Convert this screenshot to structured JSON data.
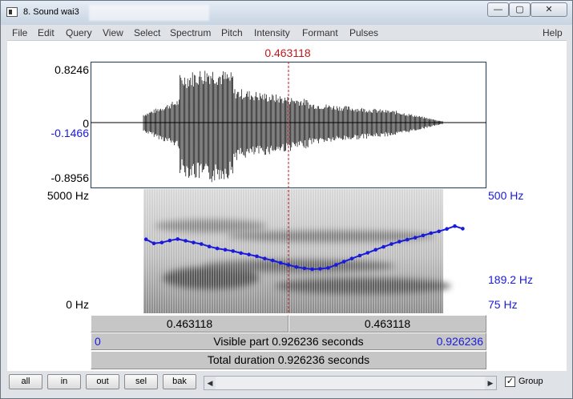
{
  "window": {
    "title": "8. Sound wai3",
    "minimize_glyph": "—",
    "maximize_glyph": "▢",
    "close_glyph": "✕"
  },
  "menu": [
    "File",
    "Edit",
    "Query",
    "View",
    "Select",
    "Spectrum",
    "Pitch",
    "Intensity",
    "Formant",
    "Pulses",
    "Help"
  ],
  "cursor": {
    "time": "0.463118",
    "fraction": 0.5,
    "color": "#c0181a"
  },
  "waveform": {
    "ymax": "0.8246",
    "zero": "0",
    "cursor_value": "-0.1466",
    "ymin": "-0.8956",
    "amp_max": 0.8246,
    "amp_min": -0.8956,
    "cursor_amp": -0.1466
  },
  "spectrogram": {
    "freq_max": "5000 Hz",
    "freq_min": "0 Hz",
    "pitch_max": "500 Hz",
    "pitch_value": "189.2 Hz",
    "pitch_min": "75 Hz",
    "pitch_ceiling_hz": 500,
    "pitch_floor_hz": 75,
    "pitch_color": "#1a1adb"
  },
  "pitch_track": {
    "x_fraction": [
      0.14,
      0.16,
      0.18,
      0.2,
      0.22,
      0.24,
      0.26,
      0.28,
      0.3,
      0.32,
      0.34,
      0.36,
      0.38,
      0.4,
      0.42,
      0.44,
      0.46,
      0.48,
      0.5,
      0.52,
      0.54,
      0.56,
      0.58,
      0.6,
      0.62,
      0.64,
      0.66,
      0.68,
      0.7,
      0.72,
      0.74,
      0.76,
      0.78,
      0.8,
      0.82,
      0.84,
      0.86,
      0.88,
      0.9,
      0.92,
      0.94
    ],
    "hz": [
      232,
      218,
      221,
      228,
      233,
      227,
      221,
      216,
      208,
      202,
      198,
      194,
      188,
      184,
      179,
      173,
      168,
      162,
      157,
      152,
      149,
      147,
      148,
      150,
      157,
      165,
      173,
      181,
      189,
      198,
      207,
      216,
      224,
      231,
      238,
      246,
      255,
      262,
      272,
      284,
      273
    ]
  },
  "selection_bar": {
    "left_time": "0.463118",
    "right_time": "0.463118"
  },
  "visible_bar": {
    "start": "0",
    "text": "Visible part 0.926236 seconds",
    "end": "0.926236"
  },
  "total_bar": {
    "text": "Total duration 0.926236 seconds"
  },
  "buttons": [
    "all",
    "in",
    "out",
    "sel",
    "bak"
  ],
  "group": {
    "label": "Group",
    "checked": true,
    "check_glyph": "✓"
  },
  "scroll": {
    "left_arrow": "◀",
    "right_arrow": "▶"
  }
}
